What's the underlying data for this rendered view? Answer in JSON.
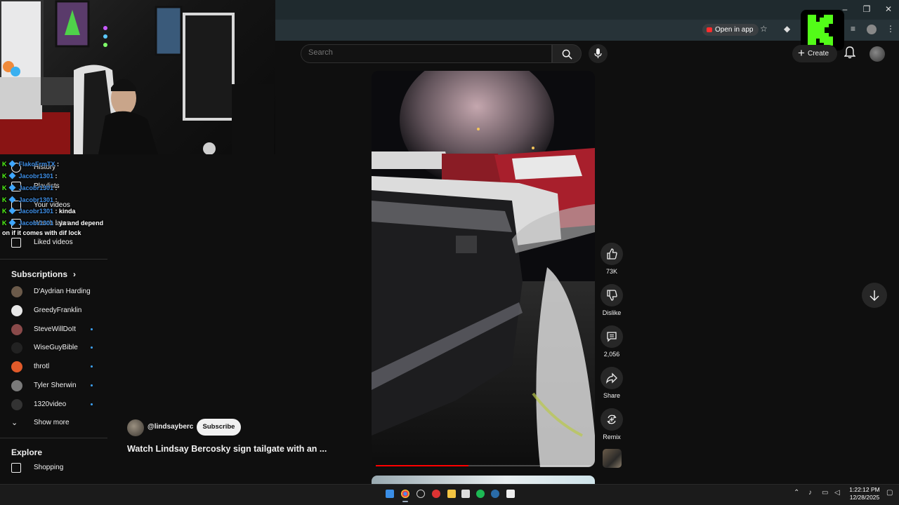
{
  "browser": {
    "open_in_app_label": "Open in app",
    "window_controls": {
      "minimize": "–",
      "restore": "❐",
      "close": "✕"
    }
  },
  "header": {
    "search_placeholder": "Search",
    "create_label": "Create"
  },
  "sidebar": {
    "you_items": [
      {
        "label": "History",
        "icon": "history-icon"
      },
      {
        "label": "Playlists",
        "icon": "playlists-icon"
      },
      {
        "label": "Your videos",
        "icon": "your-videos-icon"
      },
      {
        "label": "Watch later",
        "icon": "watch-later-icon"
      },
      {
        "label": "Liked videos",
        "icon": "liked-videos-icon"
      }
    ],
    "subscriptions_heading": "Subscriptions",
    "subscriptions": [
      {
        "name": "D'Aydrian Harding",
        "new": false,
        "color": "#6b5a4a"
      },
      {
        "name": "GreedyFranklin",
        "new": false,
        "color": "#e8e8e8"
      },
      {
        "name": "SteveWillDoIt",
        "new": true,
        "color": "#8a4a4a"
      },
      {
        "name": "WiseGuyBible",
        "new": true,
        "color": "#222222"
      },
      {
        "name": "throtl",
        "new": true,
        "color": "#e05a2a"
      },
      {
        "name": "Tyler Sherwin",
        "new": true,
        "color": "#7a7a7a"
      },
      {
        "name": "1320video",
        "new": true,
        "color": "#333333"
      }
    ],
    "show_more_label": "Show more",
    "explore_heading": "Explore",
    "explore_items": [
      {
        "label": "Shopping",
        "icon": "shopping-icon"
      }
    ]
  },
  "chat": [
    {
      "user": "FlakoFrmTX",
      "message": ""
    },
    {
      "user": "Jacobr1301",
      "message": ""
    },
    {
      "user": "Jacobr1301",
      "message": ""
    },
    {
      "user": "Jacobr1301",
      "message": ""
    },
    {
      "user": "Jacobr1301",
      "message": "kinda"
    },
    {
      "user": "Jacobr1301",
      "message": "ya and depend"
    },
    {
      "user": "",
      "message": "on if it comes with dif lock"
    }
  ],
  "short": {
    "channel_handle": "@lindsayberc",
    "subscribe_label": "Subscribe",
    "title": "Watch Lindsay Bercosky sign tailgate with an ...",
    "progress": 0.43,
    "actions": {
      "like_count": "73K",
      "dislike_label": "Dislike",
      "comment_count": "2,056",
      "share_label": "Share",
      "remix_label": "Remix"
    }
  },
  "taskbar": {
    "time": "1:22:12 PM",
    "date": "12/28/2025"
  },
  "colors": {
    "background": "#0f0f0f",
    "kick_green": "#53fc18",
    "progress_red": "#ff0000",
    "chat_user_blue": "#3f8fe6"
  }
}
